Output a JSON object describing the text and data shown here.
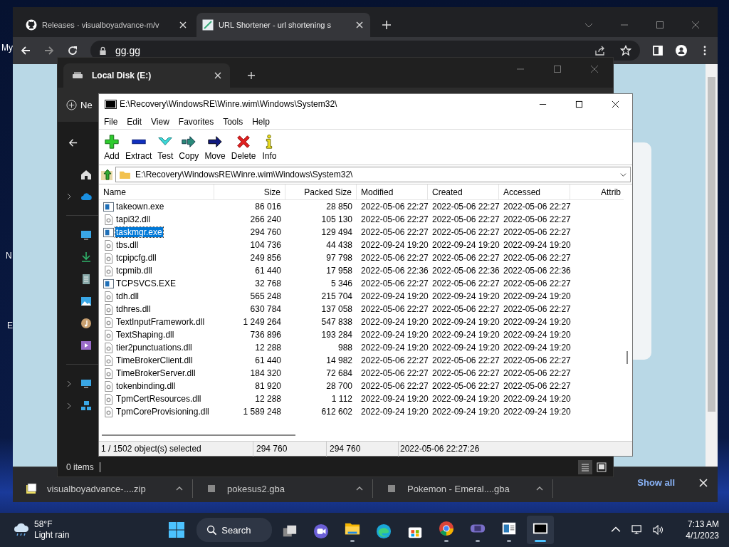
{
  "desktop_labels": [
    "My",
    "N",
    "E"
  ],
  "browser": {
    "tabs": [
      {
        "title": "Releases · visualboyadvance-m/v",
        "kind": "github",
        "selected": false
      },
      {
        "title": "URL Shortener - url shortening s",
        "kind": "link",
        "selected": true
      }
    ],
    "url": "gg.gg",
    "downloads": [
      {
        "name": "visualboyadvance-....zip",
        "kind": "zip"
      },
      {
        "name": "pokesus2.gba",
        "kind": "file"
      },
      {
        "name": "Pokemon - Emeral....gba",
        "kind": "file"
      }
    ],
    "show_all": "Show all"
  },
  "explorer": {
    "tab": "Local Disk (E:)",
    "new_button": "Ne",
    "status": "0 items"
  },
  "sevenzip": {
    "title": "E:\\Recovery\\WindowsRE\\Winre.wim\\Windows\\System32\\",
    "menu": [
      "File",
      "Edit",
      "View",
      "Favorites",
      "Tools",
      "Help"
    ],
    "toolbar": [
      {
        "label": "Add",
        "kind": "add"
      },
      {
        "label": "Extract",
        "kind": "extract"
      },
      {
        "label": "Test",
        "kind": "test"
      },
      {
        "label": "Copy",
        "kind": "copy"
      },
      {
        "label": "Move",
        "kind": "move"
      },
      {
        "label": "Delete",
        "kind": "delete"
      },
      {
        "label": "Info",
        "kind": "info"
      }
    ],
    "path": "E:\\Recovery\\WindowsRE\\Winre.wim\\Windows\\System32\\",
    "columns": [
      "Name",
      "Size",
      "Packed Size",
      "Modified",
      "Created",
      "Accessed",
      "Attrib"
    ],
    "rows": [
      {
        "name": "takeown.exe",
        "kind": "exe",
        "size": "86 016",
        "packed": "28 850",
        "modified": "2022-05-06 22:27",
        "created": "2022-05-06 22:27",
        "accessed": "2022-05-06 22:27",
        "selected": false
      },
      {
        "name": "tapi32.dll",
        "kind": "dll",
        "size": "266 240",
        "packed": "105 130",
        "modified": "2022-05-06 22:27",
        "created": "2022-05-06 22:27",
        "accessed": "2022-05-06 22:27",
        "selected": false
      },
      {
        "name": "taskmgr.exe",
        "kind": "exe",
        "size": "294 760",
        "packed": "129 494",
        "modified": "2022-05-06 22:27",
        "created": "2022-05-06 22:27",
        "accessed": "2022-05-06 22:27",
        "selected": true
      },
      {
        "name": "tbs.dll",
        "kind": "dll",
        "size": "104 736",
        "packed": "44 438",
        "modified": "2022-09-24 19:20",
        "created": "2022-09-24 19:20",
        "accessed": "2022-09-24 19:20",
        "selected": false
      },
      {
        "name": "tcpipcfg.dll",
        "kind": "dll",
        "size": "249 856",
        "packed": "97 798",
        "modified": "2022-05-06 22:27",
        "created": "2022-05-06 22:27",
        "accessed": "2022-05-06 22:27",
        "selected": false
      },
      {
        "name": "tcpmib.dll",
        "kind": "dll",
        "size": "61 440",
        "packed": "17 958",
        "modified": "2022-05-06 22:36",
        "created": "2022-05-06 22:36",
        "accessed": "2022-05-06 22:36",
        "selected": false
      },
      {
        "name": "TCPSVCS.EXE",
        "kind": "exe",
        "size": "32 768",
        "packed": "5 346",
        "modified": "2022-05-06 22:27",
        "created": "2022-05-06 22:27",
        "accessed": "2022-05-06 22:27",
        "selected": false
      },
      {
        "name": "tdh.dll",
        "kind": "dll",
        "size": "565 248",
        "packed": "215 704",
        "modified": "2022-09-24 19:20",
        "created": "2022-09-24 19:20",
        "accessed": "2022-09-24 19:20",
        "selected": false
      },
      {
        "name": "tdhres.dll",
        "kind": "dll",
        "size": "630 784",
        "packed": "137 058",
        "modified": "2022-05-06 22:27",
        "created": "2022-05-06 22:27",
        "accessed": "2022-05-06 22:27",
        "selected": false
      },
      {
        "name": "TextInputFramework.dll",
        "kind": "dll",
        "size": "1 249 264",
        "packed": "547 838",
        "modified": "2022-09-24 19:20",
        "created": "2022-09-24 19:20",
        "accessed": "2022-09-24 19:20",
        "selected": false
      },
      {
        "name": "TextShaping.dll",
        "kind": "dll",
        "size": "736 896",
        "packed": "193 284",
        "modified": "2022-09-24 19:20",
        "created": "2022-09-24 19:20",
        "accessed": "2022-09-24 19:20",
        "selected": false
      },
      {
        "name": "tier2punctuations.dll",
        "kind": "dll",
        "size": "12 288",
        "packed": "988",
        "modified": "2022-09-24 19:20",
        "created": "2022-09-24 19:20",
        "accessed": "2022-09-24 19:20",
        "selected": false
      },
      {
        "name": "TimeBrokerClient.dll",
        "kind": "dll",
        "size": "61 440",
        "packed": "14 982",
        "modified": "2022-05-06 22:27",
        "created": "2022-05-06 22:27",
        "accessed": "2022-05-06 22:27",
        "selected": false
      },
      {
        "name": "TimeBrokerServer.dll",
        "kind": "dll",
        "size": "184 320",
        "packed": "72 684",
        "modified": "2022-05-06 22:27",
        "created": "2022-05-06 22:27",
        "accessed": "2022-05-06 22:27",
        "selected": false
      },
      {
        "name": "tokenbinding.dll",
        "kind": "dll",
        "size": "81 920",
        "packed": "28 700",
        "modified": "2022-05-06 22:27",
        "created": "2022-05-06 22:27",
        "accessed": "2022-05-06 22:27",
        "selected": false
      },
      {
        "name": "TpmCertResources.dll",
        "kind": "dll",
        "size": "12 288",
        "packed": "1 112",
        "modified": "2022-09-24 19:20",
        "created": "2022-09-24 19:20",
        "accessed": "2022-09-24 19:20",
        "selected": false
      },
      {
        "name": "TpmCoreProvisioning.dll",
        "kind": "dll",
        "size": "1 589 248",
        "packed": "612 602",
        "modified": "2022-09-24 19:20",
        "created": "2022-09-24 19:20",
        "accessed": "2022-09-24 19:20",
        "selected": false
      }
    ],
    "status": [
      "1 / 1502 object(s) selected",
      "294 760",
      "294 760",
      "2022-05-06 22:27:26"
    ]
  },
  "taskbar": {
    "temperature": "58°F",
    "weather": "Light rain",
    "search": "Search",
    "apps": [
      {
        "kind": "taskview",
        "running": false,
        "selected": false
      },
      {
        "kind": "meet",
        "running": false,
        "selected": false
      },
      {
        "kind": "folder",
        "running": true,
        "selected": false
      },
      {
        "kind": "edge",
        "running": false,
        "selected": false
      },
      {
        "kind": "store",
        "running": false,
        "selected": false
      },
      {
        "kind": "chrome",
        "running": true,
        "selected": false
      },
      {
        "kind": "gba",
        "running": true,
        "selected": false
      },
      {
        "kind": "notepad",
        "running": true,
        "selected": false
      },
      {
        "kind": "sevenzip",
        "running": true,
        "selected": true
      }
    ],
    "time": "7:13 AM",
    "date": "4/1/2023"
  }
}
